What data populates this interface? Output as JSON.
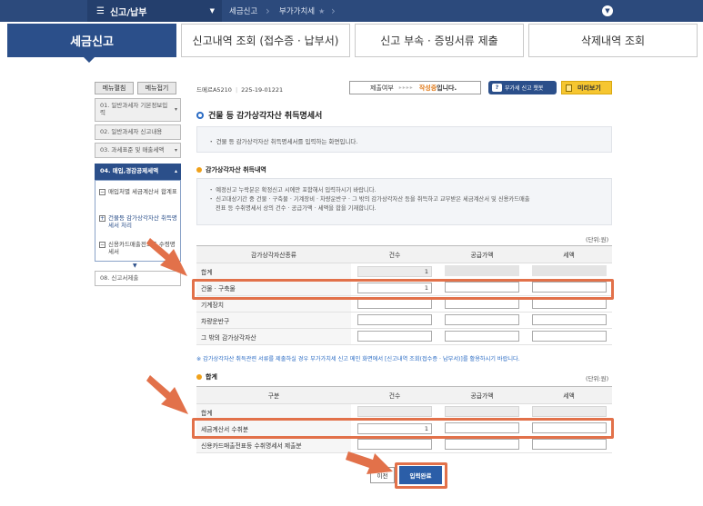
{
  "topbar": {
    "menu_label": "신고/납부",
    "crumbs": [
      "세금신고",
      "부가가치세"
    ]
  },
  "tabs": [
    {
      "label": "세금신고",
      "active": true
    },
    {
      "label": "신고내역 조회 (접수증 · 납부서)",
      "active": false
    },
    {
      "label": "신고 부속 · 증빙서류 제출",
      "active": false
    },
    {
      "label": "삭제내역 조회",
      "active": false
    }
  ],
  "sidebar": {
    "expand_label": "메뉴펼침",
    "collapse_label": "메뉴접기",
    "steps": [
      {
        "label": "01. 일반과세자 기본정보입력"
      },
      {
        "label": "02. 일반과세자 신고내용"
      },
      {
        "label": "03. 과세표준 및 매출세액"
      },
      {
        "label": "04. 매입,경감공제세액"
      },
      {
        "label": "08. 신고서제출"
      }
    ],
    "substeps": [
      {
        "label": "매입처별 세금계산서 합계표",
        "box": "−"
      },
      {
        "label": "건물등 감가상각자산 취득명세서 처리",
        "box": "+"
      },
      {
        "label": "신용카드매출전표등 수령명세서",
        "box": "−"
      }
    ]
  },
  "header": {
    "form_code": "드메르A5210",
    "biz_no": "225-19-01221",
    "status_label": "제출여부",
    "status_arrows": "▸▸▸▸",
    "status_value": "작성중",
    "status_tail": "입니다.",
    "guide_icon": "?",
    "guide_label": "부가세 신고 챗봇",
    "preview_label": "미리보기"
  },
  "title": "건물 등 감가상각자산 취득명세서",
  "info_text": "・ 건물 등 감가상각자산 취득명세서를 입력하는 화면입니다.",
  "section1": {
    "heading": "감가상각자산 취득내역",
    "notes": [
      "・ 예정신고 누락분은 확정신고 시에만 포함해서 입력하시기 바랍니다.",
      "・ 신고대상기간 중 건물 · 구축물 · 기계장비 · 차량운반구 · 그 밖의 감가상각자산 등을 취득하고 교부받은 세금계산서 및 신용카드매출",
      "전표 등 수취명세서 상의 건수 · 공급가액 · 세액을 합을 기재합니다."
    ],
    "unit": "(단위:원)",
    "columns": [
      "감가상각자산종류",
      "건수",
      "공급가액",
      "세액"
    ],
    "rows": [
      {
        "label": "합계",
        "count": "1"
      },
      {
        "label": "건물 · 구축물",
        "count": "1"
      },
      {
        "label": "기계장치",
        "count": ""
      },
      {
        "label": "차량운반구",
        "count": ""
      },
      {
        "label": "그 밖의 감가상각자산",
        "count": ""
      }
    ],
    "footnote": "※ 감가상각자산 취득관련 서류를 제출하실 경우 부가가치세 신고 메인 화면에서 [신고내역 조회(접수증 · 납부서)]를 활용하시기 바랍니다."
  },
  "section2": {
    "heading": "합계",
    "unit": "(단위:원)",
    "columns": [
      "구분",
      "건수",
      "공급가액",
      "세액"
    ],
    "rows": [
      {
        "label": "합계",
        "count": ""
      },
      {
        "label": "세금계산서 수취분",
        "count": "1"
      },
      {
        "label": "신용카드매출전표등 수취명세서 제출분",
        "count": ""
      }
    ]
  },
  "buttons": {
    "prev": "이전",
    "done": "입력완료"
  },
  "colors": {
    "topbar": "#2c4a7c",
    "active_tab": "#2b4f8a",
    "highlight": "#e2714a",
    "status": "#e07a1a",
    "preview": "#f6c630"
  }
}
